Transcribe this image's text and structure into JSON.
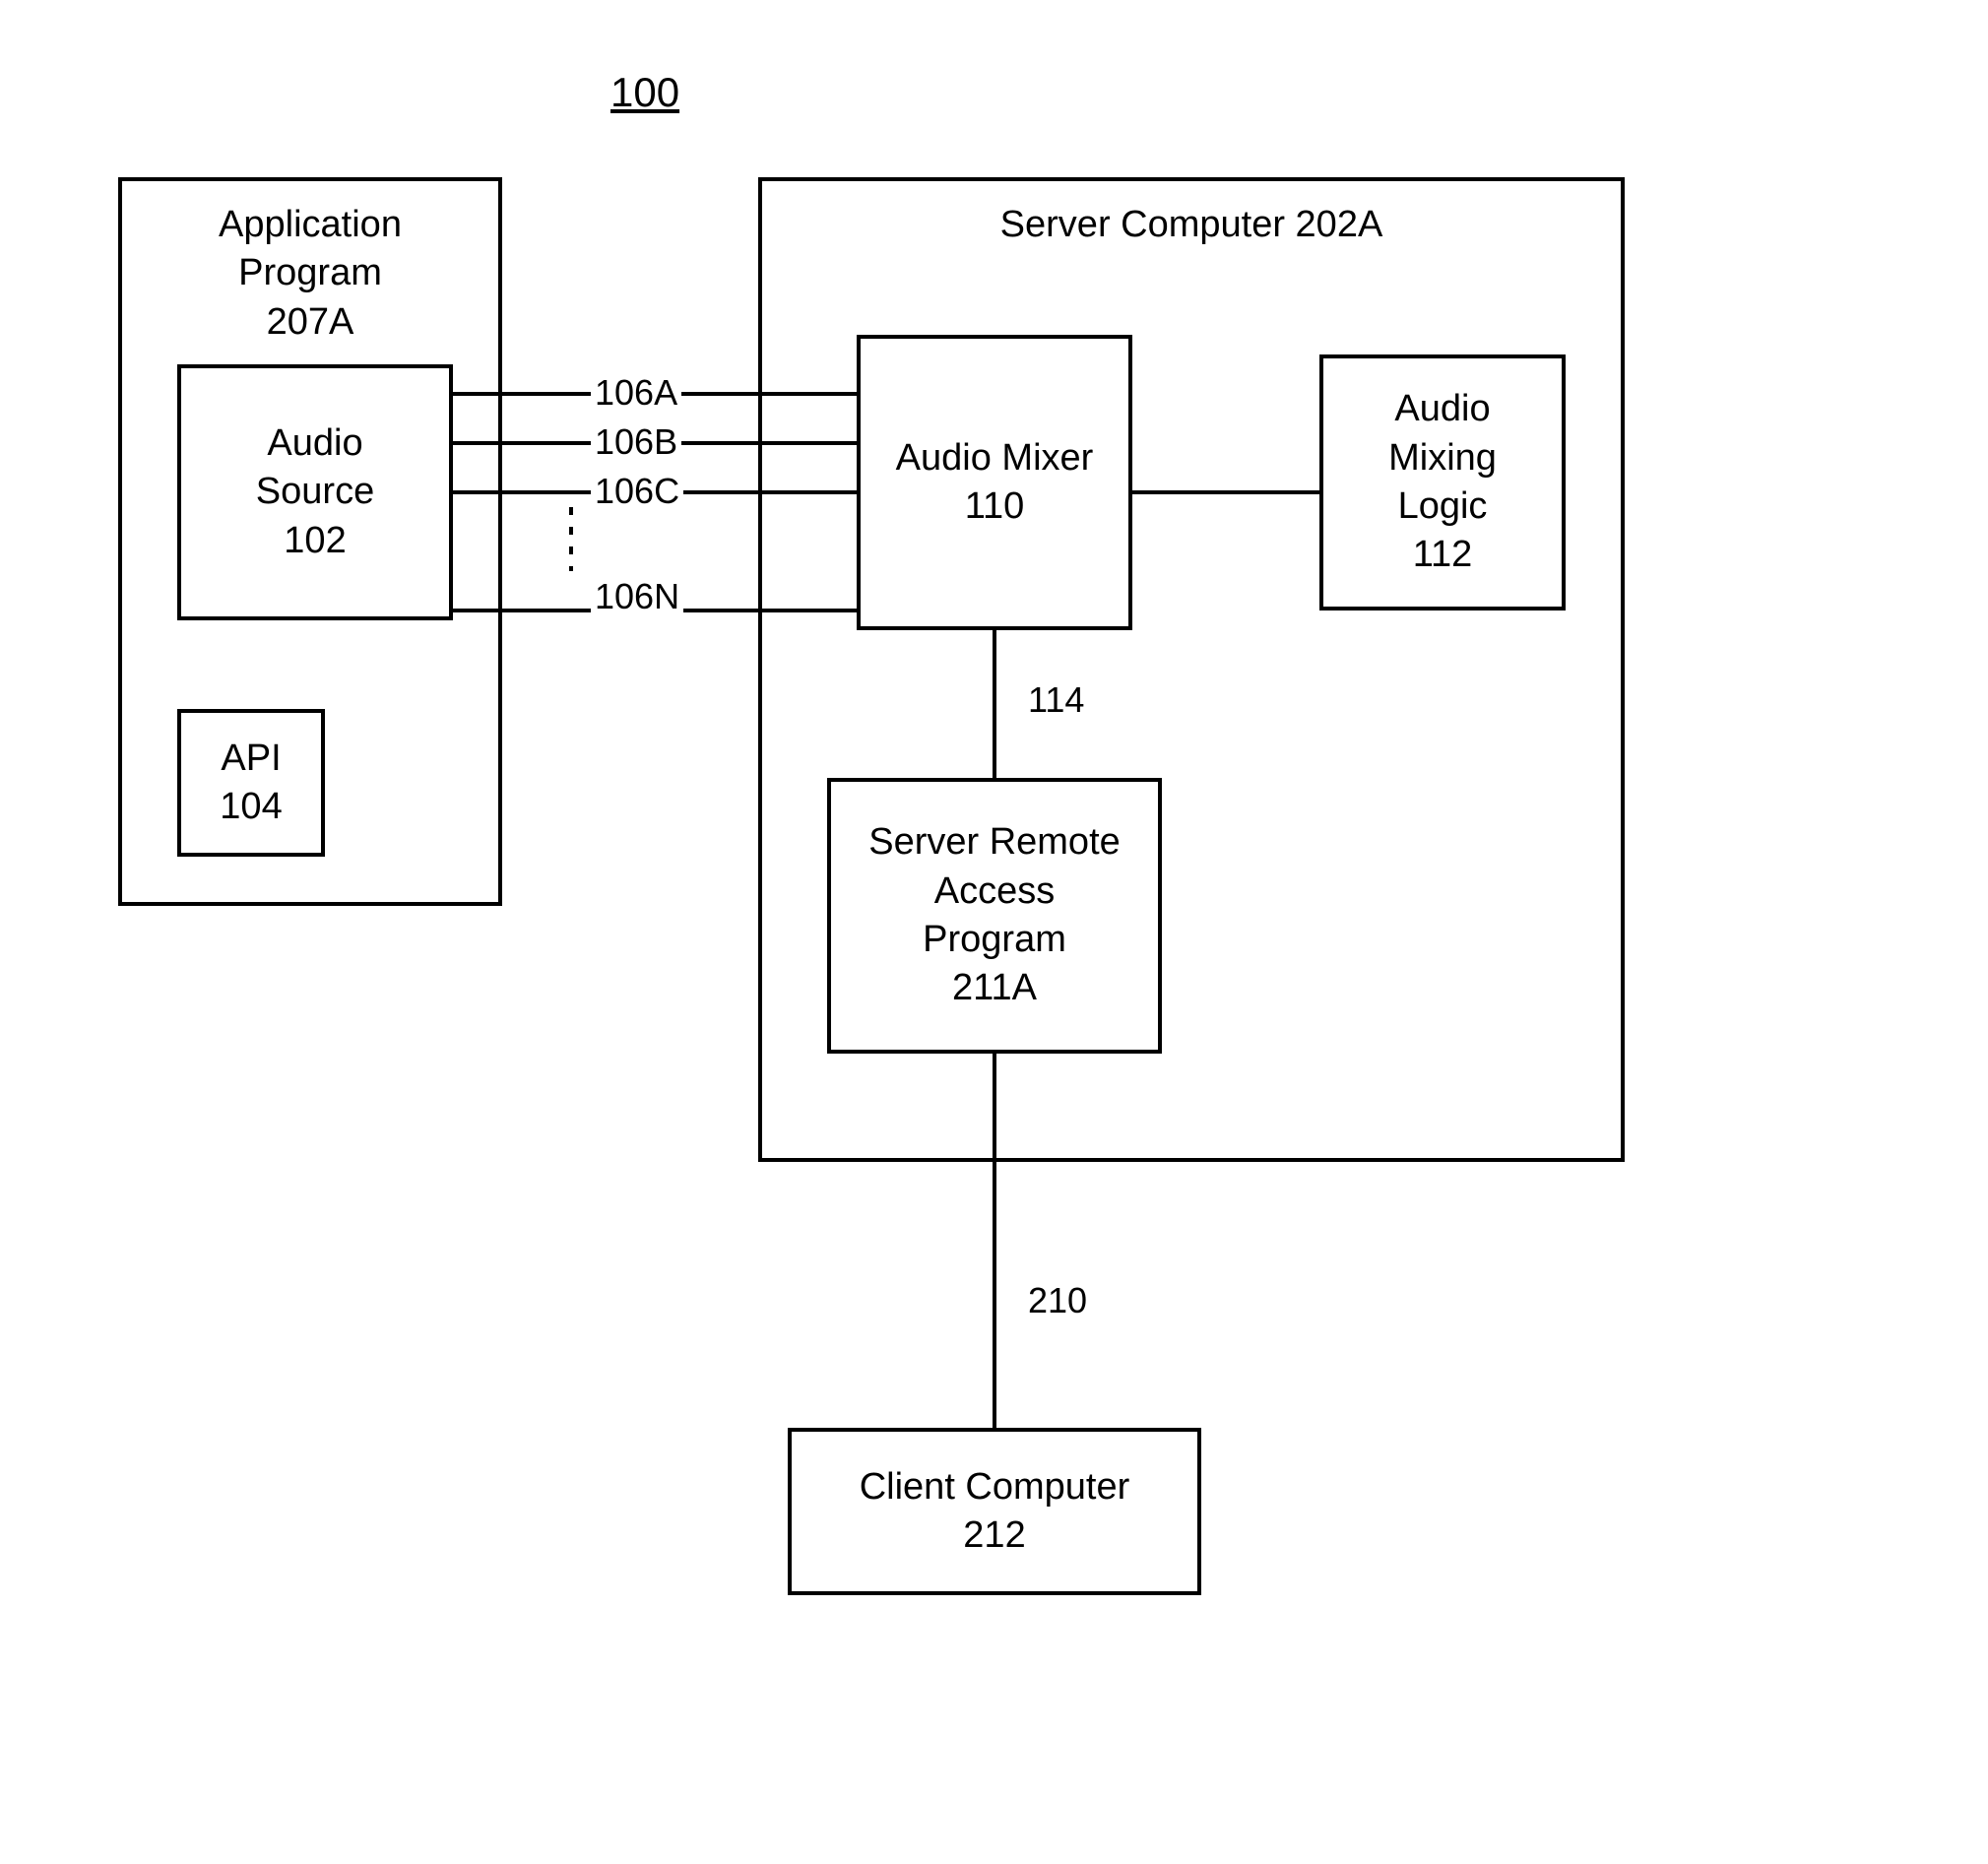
{
  "figure_id": "100",
  "application_program": {
    "title_line1": "Application",
    "title_line2": "Program",
    "id": "207A",
    "audio_source": {
      "title_line1": "Audio",
      "title_line2": "Source",
      "id": "102"
    },
    "api": {
      "title": "API",
      "id": "104"
    }
  },
  "server_computer": {
    "title": "Server Computer 202A",
    "audio_mixer": {
      "title": "Audio Mixer",
      "id": "110"
    },
    "audio_mixing_logic": {
      "title_line1": "Audio",
      "title_line2": "Mixing",
      "title_line3": "Logic",
      "id": "112"
    },
    "server_remote_access": {
      "title_line1": "Server Remote",
      "title_line2": "Access",
      "title_line3": "Program",
      "id": "211A"
    }
  },
  "client_computer": {
    "title": "Client Computer",
    "id": "212"
  },
  "connections": {
    "c106a": "106A",
    "c106b": "106B",
    "c106c": "106C",
    "c106n": "106N",
    "c114": "114",
    "c210": "210"
  }
}
